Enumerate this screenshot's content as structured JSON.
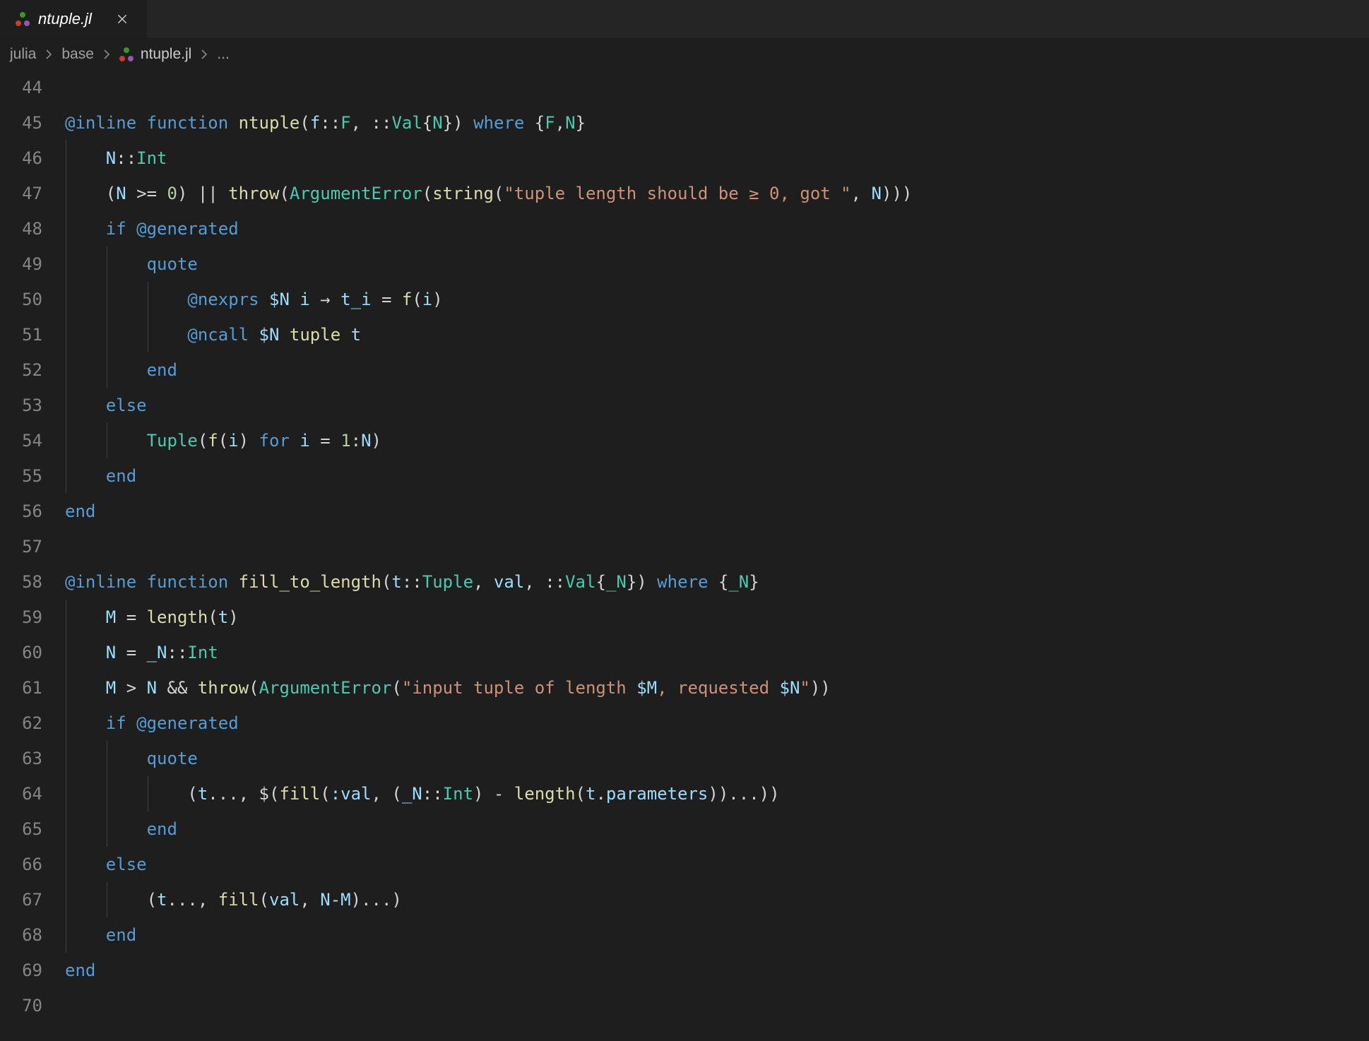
{
  "tab": {
    "icon": "julia-dots-icon",
    "filename": "ntuple.jl",
    "close_tooltip": "Close"
  },
  "breadcrumbs": {
    "items": [
      {
        "label": "julia"
      },
      {
        "label": "base"
      },
      {
        "label": "ntuple.jl",
        "icon": "julia-dots-icon"
      },
      {
        "label": "..."
      }
    ]
  },
  "gutter": {
    "start": 44,
    "end": 70
  },
  "code_lines": [
    {
      "n": 44,
      "guides": [],
      "tokens": []
    },
    {
      "n": 45,
      "guides": [],
      "tokens": [
        {
          "t": "@inline",
          "c": "mac"
        },
        {
          "t": " "
        },
        {
          "t": "function",
          "c": "kw"
        },
        {
          "t": " "
        },
        {
          "t": "ntuple",
          "c": "fn"
        },
        {
          "t": "("
        },
        {
          "t": "f",
          "c": "var"
        },
        {
          "t": "::"
        },
        {
          "t": "F",
          "c": "ty"
        },
        {
          "t": ", "
        },
        {
          "t": "::"
        },
        {
          "t": "Val",
          "c": "ty"
        },
        {
          "t": "{"
        },
        {
          "t": "N",
          "c": "ty"
        },
        {
          "t": "}"
        },
        {
          "t": ") "
        },
        {
          "t": "where",
          "c": "kw"
        },
        {
          "t": " {"
        },
        {
          "t": "F",
          "c": "ty"
        },
        {
          "t": ","
        },
        {
          "t": "N",
          "c": "ty"
        },
        {
          "t": "}"
        }
      ]
    },
    {
      "n": 46,
      "guides": [
        0
      ],
      "tokens": [
        {
          "t": "    "
        },
        {
          "t": "N",
          "c": "var"
        },
        {
          "t": "::"
        },
        {
          "t": "Int",
          "c": "ty"
        }
      ]
    },
    {
      "n": 47,
      "guides": [
        0
      ],
      "tokens": [
        {
          "t": "    ("
        },
        {
          "t": "N",
          "c": "var"
        },
        {
          "t": " >= "
        },
        {
          "t": "0",
          "c": "num"
        },
        {
          "t": ") || "
        },
        {
          "t": "throw",
          "c": "fn"
        },
        {
          "t": "("
        },
        {
          "t": "ArgumentError",
          "c": "ty"
        },
        {
          "t": "("
        },
        {
          "t": "string",
          "c": "fn"
        },
        {
          "t": "("
        },
        {
          "t": "\"tuple length should be ≥ 0, got \"",
          "c": "str"
        },
        {
          "t": ", "
        },
        {
          "t": "N",
          "c": "var"
        },
        {
          "t": ")))"
        }
      ]
    },
    {
      "n": 48,
      "guides": [
        0
      ],
      "tokens": [
        {
          "t": "    "
        },
        {
          "t": "if",
          "c": "kw"
        },
        {
          "t": " "
        },
        {
          "t": "@generated",
          "c": "mac"
        }
      ]
    },
    {
      "n": 49,
      "guides": [
        0,
        1
      ],
      "tokens": [
        {
          "t": "        "
        },
        {
          "t": "quote",
          "c": "kw"
        }
      ]
    },
    {
      "n": 50,
      "guides": [
        0,
        1,
        2
      ],
      "tokens": [
        {
          "t": "            "
        },
        {
          "t": "@nexprs",
          "c": "mac"
        },
        {
          "t": " "
        },
        {
          "t": "$N",
          "c": "var"
        },
        {
          "t": " "
        },
        {
          "t": "i",
          "c": "var"
        },
        {
          "t": " → "
        },
        {
          "t": "t_i",
          "c": "var"
        },
        {
          "t": " = "
        },
        {
          "t": "f",
          "c": "fn"
        },
        {
          "t": "("
        },
        {
          "t": "i",
          "c": "var"
        },
        {
          "t": ")"
        }
      ]
    },
    {
      "n": 51,
      "guides": [
        0,
        1,
        2
      ],
      "tokens": [
        {
          "t": "            "
        },
        {
          "t": "@ncall",
          "c": "mac"
        },
        {
          "t": " "
        },
        {
          "t": "$N",
          "c": "var"
        },
        {
          "t": " "
        },
        {
          "t": "tuple",
          "c": "fn"
        },
        {
          "t": " "
        },
        {
          "t": "t",
          "c": "var"
        }
      ]
    },
    {
      "n": 52,
      "guides": [
        0,
        1
      ],
      "tokens": [
        {
          "t": "        "
        },
        {
          "t": "end",
          "c": "kw"
        }
      ]
    },
    {
      "n": 53,
      "guides": [
        0
      ],
      "tokens": [
        {
          "t": "    "
        },
        {
          "t": "else",
          "c": "kw"
        }
      ]
    },
    {
      "n": 54,
      "guides": [
        0,
        1
      ],
      "tokens": [
        {
          "t": "        "
        },
        {
          "t": "Tuple",
          "c": "ty"
        },
        {
          "t": "("
        },
        {
          "t": "f",
          "c": "fn"
        },
        {
          "t": "("
        },
        {
          "t": "i",
          "c": "var"
        },
        {
          "t": ") "
        },
        {
          "t": "for",
          "c": "kw"
        },
        {
          "t": " "
        },
        {
          "t": "i",
          "c": "var"
        },
        {
          "t": " = "
        },
        {
          "t": "1",
          "c": "num"
        },
        {
          "t": ":"
        },
        {
          "t": "N",
          "c": "var"
        },
        {
          "t": ")"
        }
      ]
    },
    {
      "n": 55,
      "guides": [
        0
      ],
      "tokens": [
        {
          "t": "    "
        },
        {
          "t": "end",
          "c": "kw"
        }
      ]
    },
    {
      "n": 56,
      "guides": [],
      "tokens": [
        {
          "t": "end",
          "c": "kw"
        }
      ]
    },
    {
      "n": 57,
      "guides": [],
      "tokens": []
    },
    {
      "n": 58,
      "guides": [],
      "tokens": [
        {
          "t": "@inline",
          "c": "mac"
        },
        {
          "t": " "
        },
        {
          "t": "function",
          "c": "kw"
        },
        {
          "t": " "
        },
        {
          "t": "fill_to_length",
          "c": "fn"
        },
        {
          "t": "("
        },
        {
          "t": "t",
          "c": "var"
        },
        {
          "t": "::"
        },
        {
          "t": "Tuple",
          "c": "ty"
        },
        {
          "t": ", "
        },
        {
          "t": "val",
          "c": "var"
        },
        {
          "t": ", "
        },
        {
          "t": "::"
        },
        {
          "t": "Val",
          "c": "ty"
        },
        {
          "t": "{"
        },
        {
          "t": "_N",
          "c": "ty"
        },
        {
          "t": "}"
        },
        {
          "t": ") "
        },
        {
          "t": "where",
          "c": "kw"
        },
        {
          "t": " {"
        },
        {
          "t": "_N",
          "c": "ty"
        },
        {
          "t": "}"
        }
      ]
    },
    {
      "n": 59,
      "guides": [
        0
      ],
      "tokens": [
        {
          "t": "    "
        },
        {
          "t": "M",
          "c": "var"
        },
        {
          "t": " = "
        },
        {
          "t": "length",
          "c": "fn"
        },
        {
          "t": "("
        },
        {
          "t": "t",
          "c": "var"
        },
        {
          "t": ")"
        }
      ]
    },
    {
      "n": 60,
      "guides": [
        0
      ],
      "tokens": [
        {
          "t": "    "
        },
        {
          "t": "N",
          "c": "var"
        },
        {
          "t": " = "
        },
        {
          "t": "_N",
          "c": "var"
        },
        {
          "t": "::"
        },
        {
          "t": "Int",
          "c": "ty"
        }
      ]
    },
    {
      "n": 61,
      "guides": [
        0
      ],
      "tokens": [
        {
          "t": "    "
        },
        {
          "t": "M",
          "c": "var"
        },
        {
          "t": " > "
        },
        {
          "t": "N",
          "c": "var"
        },
        {
          "t": " && "
        },
        {
          "t": "throw",
          "c": "fn"
        },
        {
          "t": "("
        },
        {
          "t": "ArgumentError",
          "c": "ty"
        },
        {
          "t": "("
        },
        {
          "t": "\"input tuple of length ",
          "c": "str"
        },
        {
          "t": "$M",
          "c": "var"
        },
        {
          "t": ", requested ",
          "c": "str"
        },
        {
          "t": "$N",
          "c": "var"
        },
        {
          "t": "\"",
          "c": "str"
        },
        {
          "t": "))"
        }
      ]
    },
    {
      "n": 62,
      "guides": [
        0
      ],
      "tokens": [
        {
          "t": "    "
        },
        {
          "t": "if",
          "c": "kw"
        },
        {
          "t": " "
        },
        {
          "t": "@generated",
          "c": "mac"
        }
      ]
    },
    {
      "n": 63,
      "guides": [
        0,
        1
      ],
      "tokens": [
        {
          "t": "        "
        },
        {
          "t": "quote",
          "c": "kw"
        }
      ]
    },
    {
      "n": 64,
      "guides": [
        0,
        1,
        2
      ],
      "tokens": [
        {
          "t": "            ("
        },
        {
          "t": "t",
          "c": "var"
        },
        {
          "t": "..., "
        },
        {
          "t": "$",
          "c": "op"
        },
        {
          "t": "("
        },
        {
          "t": "fill",
          "c": "fn"
        },
        {
          "t": "("
        },
        {
          "t": ":val",
          "c": "var"
        },
        {
          "t": ", ("
        },
        {
          "t": "_N",
          "c": "var"
        },
        {
          "t": "::"
        },
        {
          "t": "Int",
          "c": "ty"
        },
        {
          "t": ") - "
        },
        {
          "t": "length",
          "c": "fn"
        },
        {
          "t": "("
        },
        {
          "t": "t",
          "c": "var"
        },
        {
          "t": "."
        },
        {
          "t": "parameters",
          "c": "var"
        },
        {
          "t": "))...))"
        }
      ]
    },
    {
      "n": 65,
      "guides": [
        0,
        1
      ],
      "tokens": [
        {
          "t": "        "
        },
        {
          "t": "end",
          "c": "kw"
        }
      ]
    },
    {
      "n": 66,
      "guides": [
        0
      ],
      "tokens": [
        {
          "t": "    "
        },
        {
          "t": "else",
          "c": "kw"
        }
      ]
    },
    {
      "n": 67,
      "guides": [
        0,
        1
      ],
      "tokens": [
        {
          "t": "        ("
        },
        {
          "t": "t",
          "c": "var"
        },
        {
          "t": "..., "
        },
        {
          "t": "fill",
          "c": "fn"
        },
        {
          "t": "("
        },
        {
          "t": "val",
          "c": "var"
        },
        {
          "t": ", "
        },
        {
          "t": "N",
          "c": "var"
        },
        {
          "t": "-"
        },
        {
          "t": "M",
          "c": "var"
        },
        {
          "t": ")...)"
        }
      ]
    },
    {
      "n": 68,
      "guides": [
        0
      ],
      "tokens": [
        {
          "t": "    "
        },
        {
          "t": "end",
          "c": "kw"
        }
      ]
    },
    {
      "n": 69,
      "guides": [],
      "tokens": [
        {
          "t": "end",
          "c": "kw"
        }
      ]
    },
    {
      "n": 70,
      "guides": [],
      "tokens": []
    }
  ]
}
